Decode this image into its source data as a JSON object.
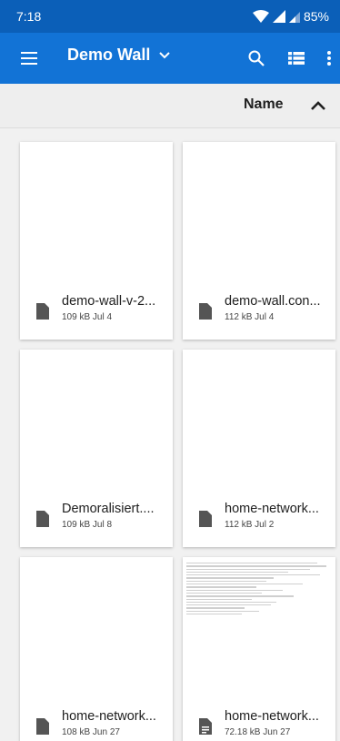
{
  "status_bar": {
    "time": "7:18",
    "battery": "85%"
  },
  "app_bar": {
    "title": "Demo Wall",
    "icons": [
      "menu-icon",
      "chevron-down-icon",
      "search-icon",
      "list-view-icon",
      "more-vert-icon"
    ]
  },
  "sort_bar": {
    "label": "Name",
    "direction_icon": "chevron-up-icon"
  },
  "files": [
    {
      "name": "demo-wall-v-2...",
      "meta": "109 kB Jul 4",
      "icon": "file-icon"
    },
    {
      "name": "demo-wall.con...",
      "meta": "112 kB Jul 4",
      "icon": "file-icon"
    },
    {
      "name": "Demoralisiert....",
      "meta": "109 kB Jul 8",
      "icon": "file-icon"
    },
    {
      "name": "home-network...",
      "meta": "112 kB Jul 2",
      "icon": "file-icon"
    },
    {
      "name": "home-network...",
      "meta": "108 kB Jun 27",
      "icon": "file-icon"
    },
    {
      "name": "home-network...",
      "meta": "72.18 kB Jun 27",
      "icon": "document-icon"
    }
  ],
  "colors": {
    "status_bar": "#0b5fb8",
    "app_bar": "#1273d6",
    "background": "#f1f1f1"
  }
}
